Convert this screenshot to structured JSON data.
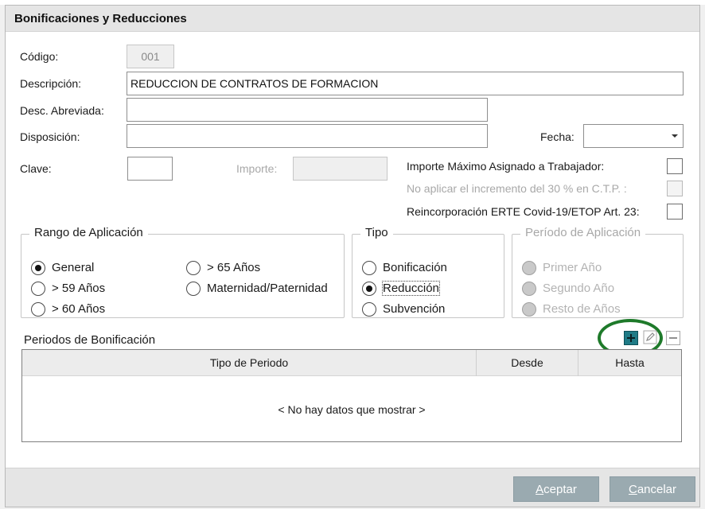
{
  "dialog": {
    "title": "Bonificaciones y Reducciones"
  },
  "form": {
    "codigo_label": "Código:",
    "codigo_value": "001",
    "descripcion_label": "Descripción:",
    "descripcion_value": "REDUCCION DE CONTRATOS DE FORMACION",
    "desc_abreviada_label": "Desc. Abreviada:",
    "desc_abreviada_value": "",
    "disposicion_label": "Disposición:",
    "disposicion_value": "",
    "fecha_label": "Fecha:",
    "fecha_value": "",
    "clave_label": "Clave:",
    "clave_value": "",
    "importe_label": "Importe:",
    "importe_value": ""
  },
  "checks": {
    "importe_maximo_label": "Importe Máximo Asignado a Trabajador:",
    "importe_maximo_checked": false,
    "no_aplicar_label": "No aplicar el incremento del 30 % en C.T.P. :",
    "no_aplicar_checked": false,
    "reincorporacion_label": "Reincorporación ERTE Covid-19/ETOP Art. 23:",
    "reincorporacion_checked": false
  },
  "rango": {
    "legend": "Rango de Aplicación",
    "options": [
      "General",
      "> 59 Años",
      "> 60 Años",
      "> 65 Años",
      "Maternidad/Paternidad"
    ],
    "selected": "General"
  },
  "tipo": {
    "legend": "Tipo",
    "options": [
      "Bonificación",
      "Reducción",
      "Subvención"
    ],
    "selected": "Reducción"
  },
  "periodo": {
    "legend": "Período de Aplicación",
    "options": [
      "Primer Año",
      "Segundo Año",
      "Resto de Años"
    ]
  },
  "periodos": {
    "label": "Periodos de Bonificación",
    "columns": [
      "Tipo de Periodo",
      "Desde",
      "Hasta"
    ],
    "empty_message": "< No hay datos que mostrar >"
  },
  "icons": {
    "add": "plus-icon",
    "edit": "pencil-icon",
    "remove": "minus-icon"
  },
  "colors": {
    "add_button": "#1f7b86",
    "highlight_ring": "#1e7a2a",
    "footer_button": "#9aaab0"
  },
  "footer": {
    "accept_first": "A",
    "accept_rest": "ceptar",
    "cancel_first": "C",
    "cancel_rest": "ancelar"
  }
}
